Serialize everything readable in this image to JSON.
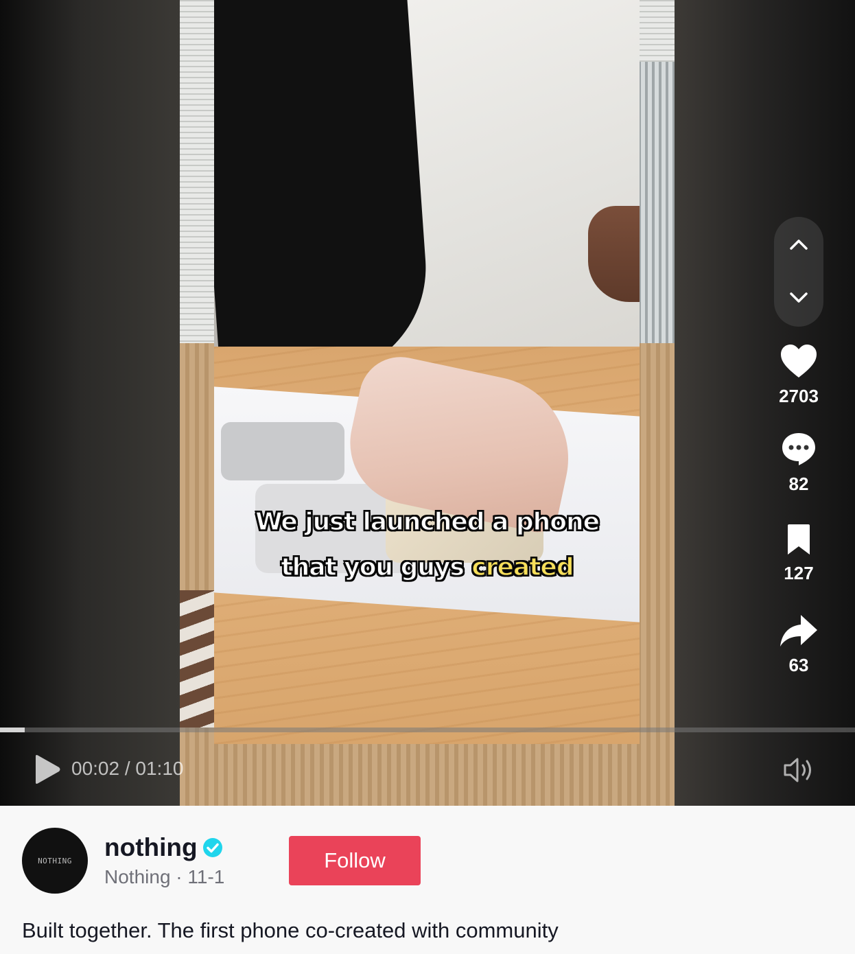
{
  "video": {
    "caption_line1": "We just launched a phone",
    "caption_line2_part1": "that you guys ",
    "caption_line2_highlight": "created",
    "current_time": "00:02",
    "duration": "01:10",
    "time_display": "00:02 / 01:10",
    "progress": 0.029
  },
  "actions": {
    "likes": "2703",
    "comments": "82",
    "saves": "127",
    "shares": "63"
  },
  "author": {
    "avatar_text": "NOTHING",
    "username": "nothing",
    "display_name": "Nothing",
    "date": "11-1",
    "meta": "Nothing · 11-1",
    "verified": true,
    "follow_label": "Follow"
  },
  "description": "Built together. The first phone co-created with community",
  "colors": {
    "follow": "#ea4359",
    "verified": "#20d5ec",
    "caption_highlight": "#f7df5a"
  },
  "icons": [
    "chevron-up-icon",
    "chevron-down-icon",
    "heart-icon",
    "comment-icon",
    "bookmark-icon",
    "share-icon",
    "play-icon",
    "volume-icon",
    "verified-badge-icon"
  ]
}
